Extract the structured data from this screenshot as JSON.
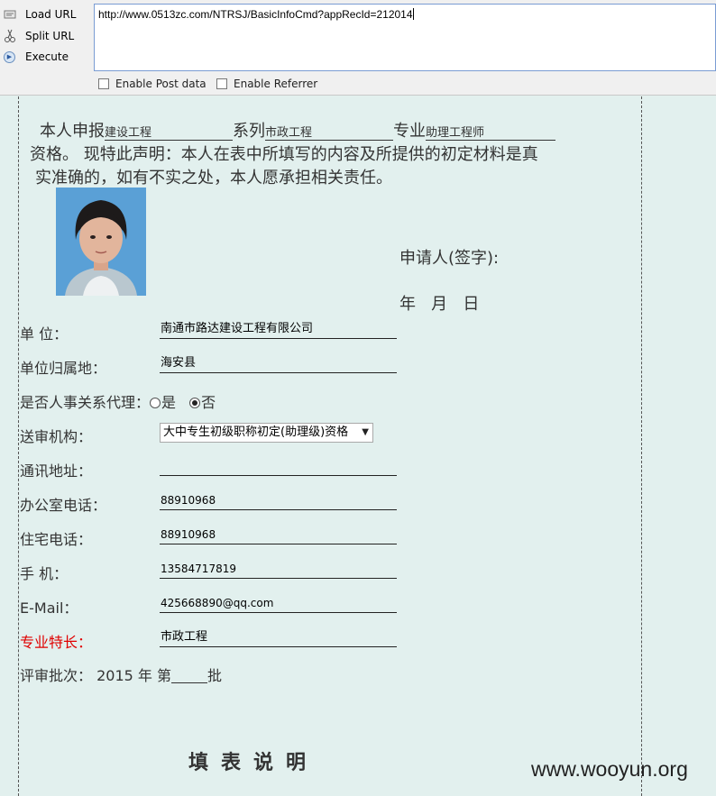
{
  "toolbar": {
    "load_url": "Load URL",
    "split_url": "Split URL",
    "execute": "Execute",
    "url": "http://www.0513zc.com/NTRSJ/BasicInfoCmd?appRecId=212014",
    "enable_post": "Enable Post data",
    "enable_referrer": "Enable Referrer"
  },
  "declaration": {
    "p1": "本人申报",
    "apply_category": "建设工程",
    "p2": "系列",
    "series": "市政工程",
    "p3": "专业",
    "major": "助理工程师",
    "line2": "资格。 现特此声明：本人在表中所填写的内容及所提供的初定材料是真",
    "line3": "实准确的，如有不实之处，本人愿承担相关责任。"
  },
  "sign": {
    "applicant": "申请人(签字):",
    "date": "年   月   日"
  },
  "form": {
    "unit_label": "单 位：",
    "unit_value": "南通市路达建设工程有限公司",
    "region_label": "单位归属地：",
    "region_value": "海安县",
    "agency_label": "是否人事关系代理：",
    "agency_yes": "是",
    "agency_no": "否",
    "review_label": "送审机构：",
    "review_value": "大中专生初级职称初定(助理级)资格",
    "address_label": "通讯地址：",
    "address_value": "",
    "office_phone_label": "办公室电话：",
    "office_phone_value": "88910968",
    "home_phone_label": "住宅电话：",
    "home_phone_value": "88910968",
    "mobile_label": "手 机：",
    "mobile_value": "13584717819",
    "email_label": "E-Mail：",
    "email_value": "425668890@qq.com",
    "specialty_label": "专业特长：",
    "specialty_value": "市政工程",
    "batch_prefix": "评审批次： 2015 年  第",
    "batch_suffix": "批"
  },
  "instructions_heading": "填表说明",
  "watermark": "www.wooyun.org",
  "colors": {
    "page_bg": "#e2f0ee",
    "toolbar_bg": "#f0f0f0",
    "specialty_label": "#e00000"
  }
}
